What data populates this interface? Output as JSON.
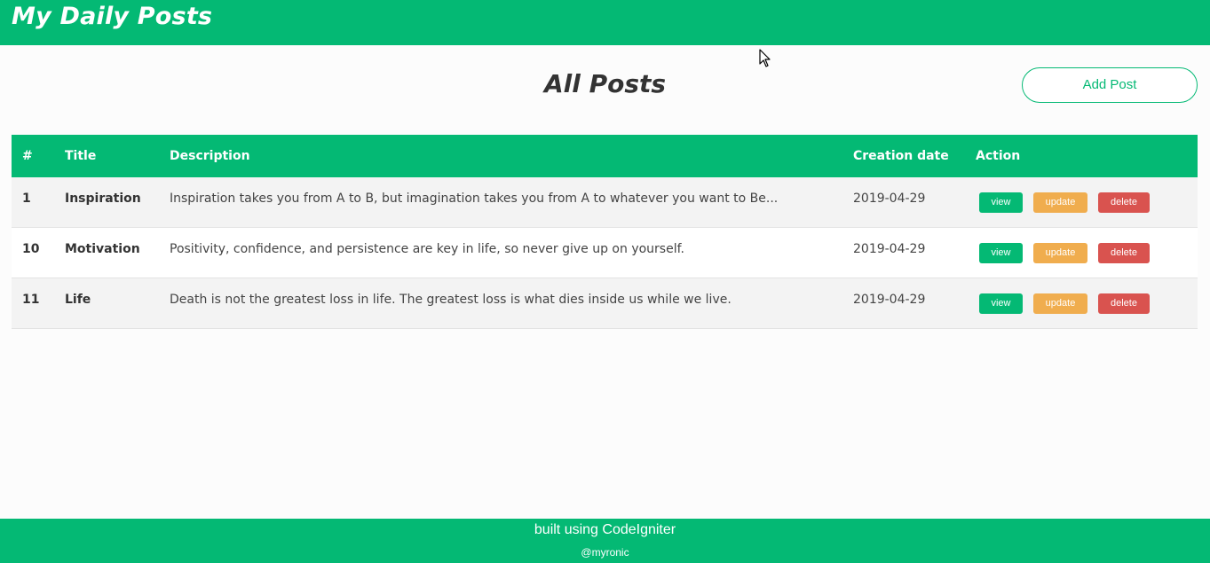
{
  "header": {
    "brand": "My Daily Posts"
  },
  "main": {
    "title": "All Posts",
    "add_button": "Add Post"
  },
  "table": {
    "columns": [
      "#",
      "Title",
      "Description",
      "Creation date",
      "Action"
    ],
    "rows": [
      {
        "id": "1",
        "title": "Inspiration",
        "description": "Inspiration takes you from A to B, but imagination takes you from A to whatever you want to Be...",
        "date": "2019-04-29"
      },
      {
        "id": "10",
        "title": "Motivation",
        "description": "Positivity, confidence, and persistence are key in life, so never give up on yourself.",
        "date": "2019-04-29"
      },
      {
        "id": "11",
        "title": "Life",
        "description": "Death is not the greatest loss in life. The greatest loss is what dies inside us while we live.",
        "date": "2019-04-29"
      }
    ],
    "actions": {
      "view": "view",
      "update": "update",
      "delete": "delete"
    }
  },
  "footer": {
    "main": "built using CodeIgniter",
    "sub": "@myronic"
  },
  "colors": {
    "accent": "#04b974",
    "update": "#f0ad4e",
    "delete": "#d9534f"
  }
}
